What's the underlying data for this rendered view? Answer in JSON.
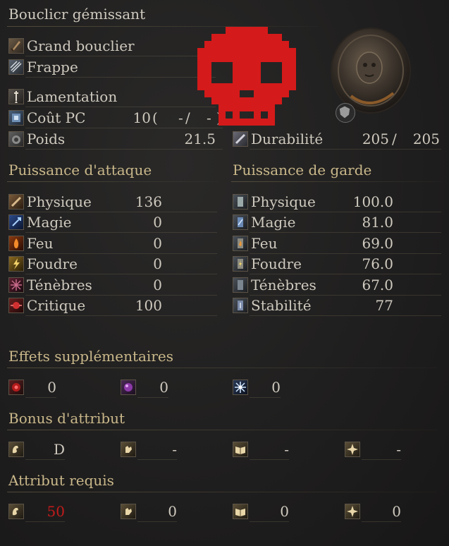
{
  "title": "Bouclicr gémissant",
  "item_type": "Grand bouclier",
  "attack_type": "Frappe",
  "skill": "Lamentation",
  "fp_cost": {
    "label": "Coût PC",
    "value": "10",
    "paren_open": "(",
    "mid": "-",
    "slash": "/",
    "mid2": "-",
    "paren_close": ")"
  },
  "weight": {
    "label": "Poids",
    "value": "21.5"
  },
  "durability": {
    "label": "Durabilité",
    "current": "205",
    "slash": "/",
    "max": "205"
  },
  "attack_power": {
    "heading": "Puissance d'attaque",
    "rows": [
      {
        "label": "Physique",
        "value": "136"
      },
      {
        "label": "Magie",
        "value": "0"
      },
      {
        "label": "Feu",
        "value": "0"
      },
      {
        "label": "Foudre",
        "value": "0"
      },
      {
        "label": "Ténèbres",
        "value": "0"
      },
      {
        "label": "Critique",
        "value": "100"
      }
    ]
  },
  "guard_power": {
    "heading": "Puissance de garde",
    "rows": [
      {
        "label": "Physique",
        "value": "100.0"
      },
      {
        "label": "Magie",
        "value": "81.0"
      },
      {
        "label": "Feu",
        "value": "69.0"
      },
      {
        "label": "Foudre",
        "value": "76.0"
      },
      {
        "label": "Ténèbres",
        "value": "67.0"
      },
      {
        "label": "Stabilité",
        "value": "77"
      }
    ]
  },
  "additional_effects": {
    "heading": "Effets supplémentaires",
    "values": [
      "0",
      "0",
      "0"
    ]
  },
  "attribute_bonus": {
    "heading": "Bonus d'attribut",
    "values": [
      "D",
      "-",
      "-",
      "-"
    ]
  },
  "attribute_required": {
    "heading": "Attribut requis",
    "values": [
      "50",
      "0",
      "0",
      "0"
    ]
  },
  "colors": {
    "requirement_unmet": "#c21b1b",
    "heading": "#c9b88a",
    "skull": "#d41a1a"
  }
}
